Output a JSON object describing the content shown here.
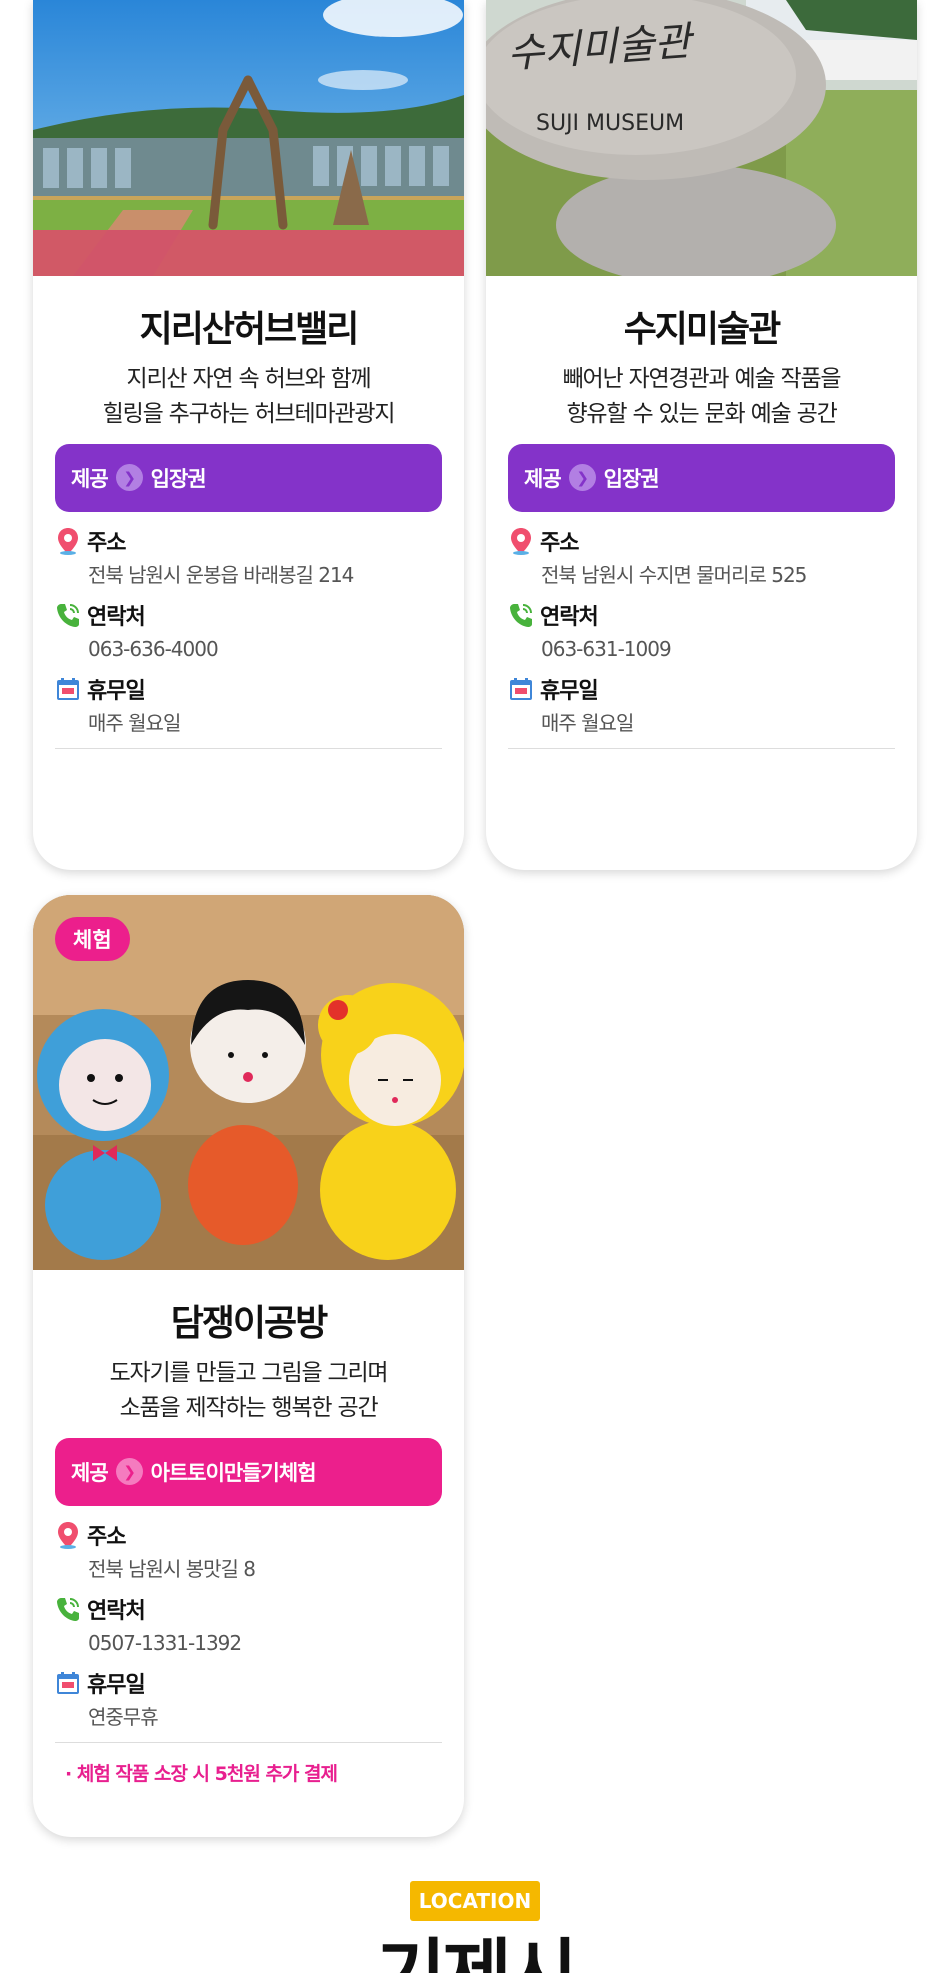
{
  "cards": [
    {
      "title": "지리산허브밸리",
      "desc_line1": "지리산 자연 속 허브와 함께",
      "desc_line2": "힐링을 추구하는 허브테마관광지",
      "offer_prefix": "제공",
      "offer_label": "입장권",
      "offer_color": "#8433c9",
      "address_label": "주소",
      "address_value": "전북 남원시 운봉읍 바래봉길 214",
      "phone_label": "연락처",
      "phone_value": "063-636-4000",
      "closed_label": "휴무일",
      "closed_value": "매주 월요일"
    },
    {
      "title": "수지미술관",
      "desc_line1": "빼어난 자연경관과 예술 작품을",
      "desc_line2": "향유할 수 있는 문화 예술 공간",
      "offer_prefix": "제공",
      "offer_label": "입장권",
      "offer_color": "#8433c9",
      "address_label": "주소",
      "address_value": "전북 남원시 수지면 물머리로 525",
      "phone_label": "연락처",
      "phone_value": "063-631-1009",
      "closed_label": "휴무일",
      "closed_value": "매주 월요일",
      "image_sign_text": "SUJI MUSEUM"
    },
    {
      "badge": "체험",
      "title": "담쟁이공방",
      "desc_line1": "도자기를 만들고 그림을 그리며",
      "desc_line2": "소품을 제작하는 행복한 공간",
      "offer_prefix": "제공",
      "offer_label": "아트토이만들기체험",
      "offer_color": "#ec1f8c",
      "address_label": "주소",
      "address_value": "전북 남원시 봉맛길 8",
      "phone_label": "연락처",
      "phone_value": "0507-1331-1392",
      "closed_label": "휴무일",
      "closed_value": "연중무휴",
      "note": "· 체험 작품 소장 시 5천원 추가 결제"
    }
  ],
  "location": {
    "badge": "LOCATION",
    "title": "기제시"
  },
  "icons": {
    "address": "map-pin-icon",
    "phone": "phone-icon",
    "closed": "calendar-icon",
    "arrow": "chevron-right-icon"
  }
}
